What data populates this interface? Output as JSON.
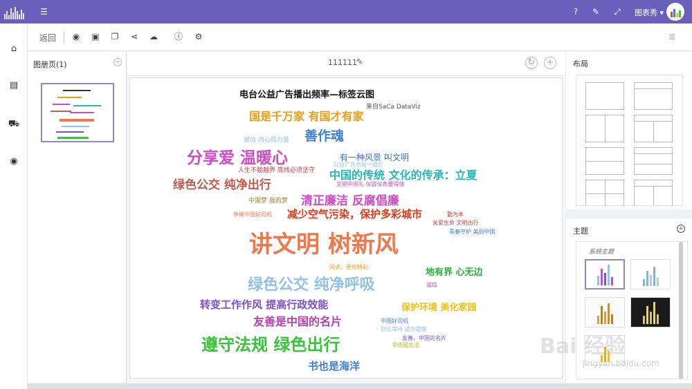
{
  "topbar": {
    "user_name": "图表秀 ▾",
    "icons": [
      "logo-icon",
      "menu-toggle-icon",
      "help-icon",
      "edit-icon",
      "fullscreen-icon"
    ]
  },
  "leftnav": {
    "icons": [
      "home-icon",
      "book-icon",
      "cart-icon",
      "globe-icon"
    ]
  },
  "toolbar": {
    "back_label": "返回",
    "icons": [
      "preview-eye-icon",
      "save-icon",
      "copy-icon",
      "share-icon",
      "cloud-upload-icon",
      "info-icon",
      "settings-icon",
      "list-icon"
    ]
  },
  "album": {
    "title": "图册页(1)"
  },
  "canvas": {
    "page_name": "111111"
  },
  "chart_data": {
    "type": "wordcloud",
    "title": "电台公益广告播出频率—标签云图",
    "subtitle": "来自SaCa DataViz",
    "words": [
      {
        "text": "讲文明 树新风",
        "color": "#f0784b"
      },
      {
        "text": "绿色公交 纯净呼吸",
        "color": "#8fc3ec"
      },
      {
        "text": "遵守法规 绿色出行",
        "color": "#38c43a"
      },
      {
        "text": "分享爱 温暖心",
        "color": "#d14bc9"
      },
      {
        "text": "善作魂",
        "color": "#3f7fd6"
      },
      {
        "text": "国是千万家 有国才有家",
        "color": "#f39b13"
      },
      {
        "text": "绿色公交 纯净出行",
        "color": "#c35a52"
      },
      {
        "text": "中国的传统 文化的传承：立夏",
        "color": "#26b8b3"
      },
      {
        "text": "清正廉洁 反腐倡廉",
        "color": "#d14bc9"
      },
      {
        "text": "减少空气污染，保护多彩城市",
        "color": "#e03a18"
      },
      {
        "text": "转变工作作风 提高行政效能",
        "color": "#7a4fd1"
      },
      {
        "text": "友善是中国的名片",
        "color": "#b83fb0"
      },
      {
        "text": "书也是海洋",
        "color": "#3a7fe0"
      },
      {
        "text": "有一种风景 叫文明",
        "color": "#3a6fd0"
      },
      {
        "text": "保护环境 美化家园",
        "color": "#f2c012"
      },
      {
        "text": "地有界 心无边",
        "color": "#27b339"
      },
      {
        "text": "诚信 内心的力量",
        "color": "#8fc3ec"
      },
      {
        "text": "人生不能越界 底线必须坚守",
        "color": "#d14040"
      },
      {
        "text": "公益广告也是一道灯",
        "color": "#8fc3ec"
      },
      {
        "text": "文明中国礼 仪容仪表要得体",
        "color": "#d14bc9"
      },
      {
        "text": "中国梦 我的梦",
        "color": "#b07a2a"
      },
      {
        "text": "争做中国好司机",
        "color": "#f0784b"
      },
      {
        "text": "勤为本",
        "color": "#b04030"
      },
      {
        "text": "关爱生命 文明出行",
        "color": "#d14040"
      },
      {
        "text": "青春守护 美丽中国",
        "color": "#3f7fd6"
      },
      {
        "text": "阅读，更加精彩",
        "color": "#f39b13"
      },
      {
        "text": "诚信",
        "color": "#d14bc9"
      },
      {
        "text": "中国好司机",
        "color": "#3f7fd6"
      },
      {
        "text": "别让等待 成为遗憾",
        "color": "#8fc3ec"
      },
      {
        "text": "友善，中国的名片",
        "color": "#7a4fd1"
      },
      {
        "text": "书也是生活",
        "color": "#b8c012"
      }
    ]
  },
  "right_panel": {
    "layout_title": "布局",
    "theme_title": "主题",
    "system_theme_label": "系统主题"
  },
  "watermark": {
    "line1": "Bai 经验",
    "line2": "jingyan.baidu.com"
  }
}
